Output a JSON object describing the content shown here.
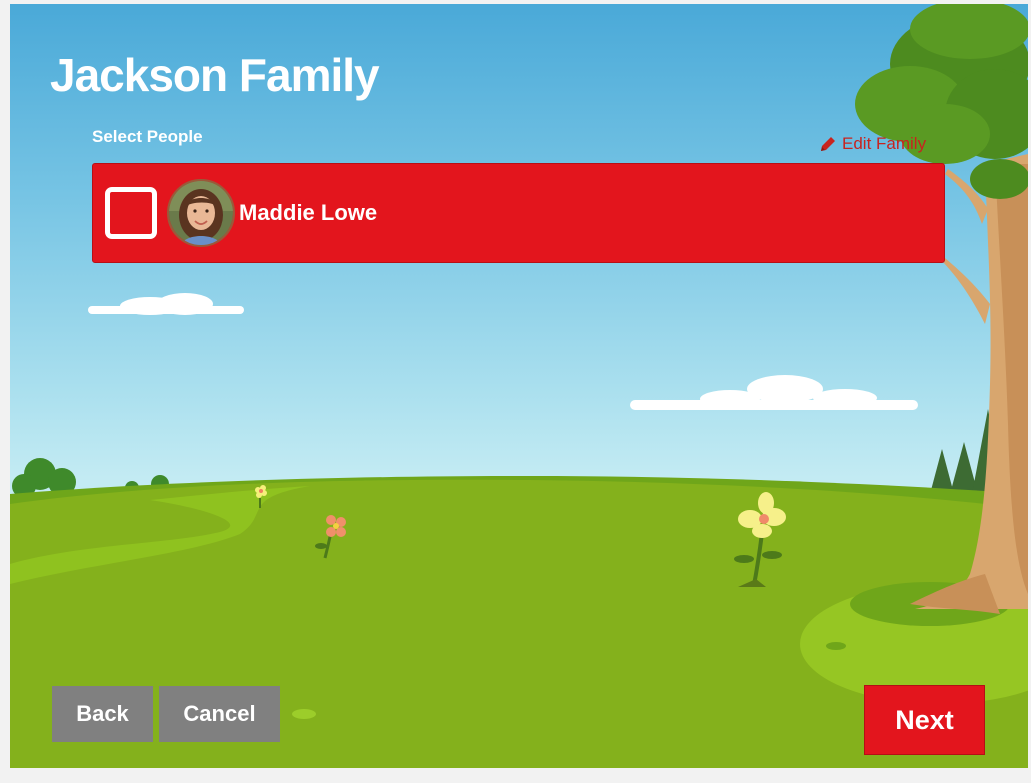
{
  "header": {
    "title": "Jackson Family",
    "subtitle": "Select People",
    "edit_family_label": "Edit Family"
  },
  "people": [
    {
      "name": "Maddie Lowe",
      "selected": false
    }
  ],
  "footer": {
    "back_label": "Back",
    "cancel_label": "Cancel",
    "next_label": "Next"
  },
  "icons": {
    "edit": "pencil-icon",
    "checkbox": "checkbox-icon"
  },
  "colors": {
    "accent": "#e3151d",
    "secondary_button": "#808080",
    "edit_link": "#c8241f",
    "sky": "#76c4e4",
    "grass": "#84b11c"
  }
}
